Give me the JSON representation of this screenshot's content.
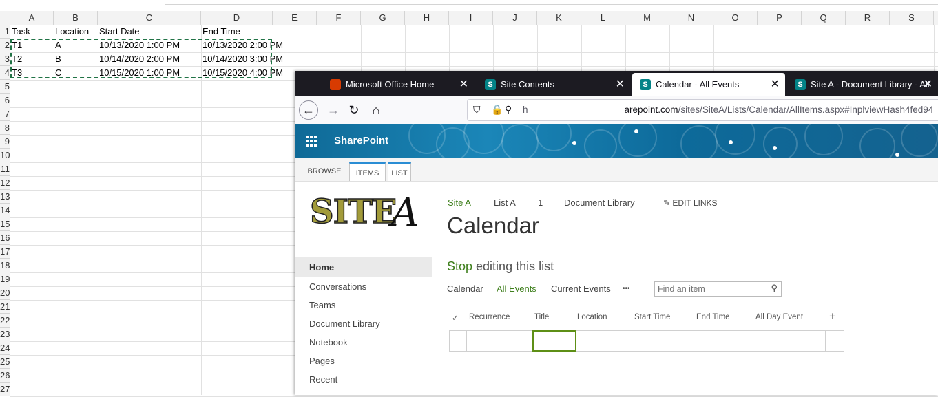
{
  "excel": {
    "columns": [
      "A",
      "B",
      "C",
      "D",
      "E",
      "F",
      "G",
      "H",
      "I",
      "J",
      "K",
      "L",
      "M",
      "N",
      "O",
      "P",
      "Q",
      "R",
      "S"
    ],
    "row_numbers": [
      "1",
      "2",
      "3",
      "4",
      "5",
      "6",
      "7",
      "8",
      "9",
      "10",
      "11",
      "12",
      "13",
      "14",
      "15",
      "16",
      "17",
      "18",
      "19",
      "20",
      "21",
      "22",
      "23",
      "24",
      "25",
      "26",
      "27"
    ],
    "headers": [
      "Task",
      "Location",
      "Start Date",
      "End Time"
    ],
    "rows": [
      [
        "T1",
        "A",
        "10/13/2020 1:00 PM",
        "10/13/2020 2:00 PM"
      ],
      [
        "T2",
        "B",
        "10/14/2020 2:00 PM",
        "10/14/2020 3:00 PM"
      ],
      [
        "T3",
        "C",
        "10/15/2020 1:00 PM",
        "10/15/2020 4:00 PM"
      ]
    ]
  },
  "browser": {
    "tabs": [
      {
        "title": "Microsoft Office Home",
        "icon": "office-icon",
        "active": false
      },
      {
        "title": "Site Contents",
        "icon": "sharepoint-icon",
        "active": false
      },
      {
        "title": "Calendar - All Events",
        "icon": "sharepoint-icon",
        "active": true
      },
      {
        "title": "Site A - Document Library - All",
        "icon": "sharepoint-icon",
        "active": false
      }
    ],
    "close_glyph": "✕",
    "url_prefix": "h",
    "url_domain": "arepoint.com",
    "url_path": "/sites/SiteA/Lists/Calendar/AllItems.aspx#InplviewHash4fed94"
  },
  "sharepoint": {
    "brand": "SharePoint",
    "ribbon_tabs": [
      "BROWSE",
      "ITEMS",
      "LIST"
    ],
    "logo_text": "SITE",
    "logo_a": "A",
    "breadcrumbs": [
      "Site A",
      "List A",
      "1",
      "Document Library"
    ],
    "edit_links": "EDIT LINKS",
    "page_title": "Calendar",
    "left_nav": [
      "Home",
      "Conversations",
      "Teams",
      "Document Library",
      "Notebook",
      "Pages",
      "Recent"
    ],
    "stop_editing_prefix": "Stop",
    "stop_editing_rest": " editing this list",
    "views": [
      "Calendar",
      "All Events",
      "Current Events"
    ],
    "more_glyph": "•••",
    "search_placeholder": "Find an item",
    "columns": [
      "Recurrence",
      "Title",
      "Location",
      "Start Time",
      "End Time",
      "All Day Event"
    ],
    "check_glyph": "✓",
    "add_glyph": "+",
    "accent_green": "#3f7f1d",
    "banner_blue": "#0f6a97"
  }
}
